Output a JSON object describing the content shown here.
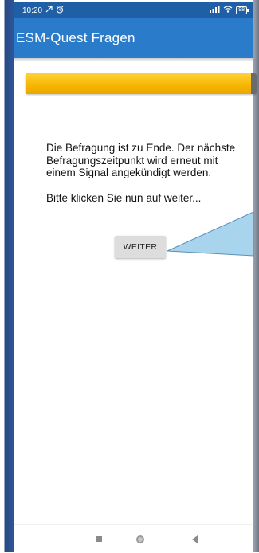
{
  "status_bar": {
    "time": "10:20",
    "notification_icons": [
      "missed-call-icon",
      "alarm-icon"
    ],
    "signal_icon": "signal-icon",
    "wifi_icon": "wifi-icon",
    "battery_level": "98"
  },
  "app_bar": {
    "title": "ESM-Quest Fragen"
  },
  "progress": {
    "fraction": 0.975
  },
  "main": {
    "end_text": "Die Befragung ist zu Ende. Der nächste Befragungszeitpunkt wird erneut mit einem Signal angekündigt werden.",
    "prompt_text": "Bitte klicken Sie nun auf weiter...",
    "weiter_label": "WEITER"
  },
  "nav_bar": {
    "buttons": [
      "recent-apps-icon",
      "home-icon",
      "back-icon"
    ]
  },
  "colors": {
    "status_bar": "#1f5fa5",
    "app_bar": "#2a7bc9",
    "progress_fill": "#f7b500",
    "progress_track": "#6b6b6b",
    "callout": "#a9d4ee"
  }
}
